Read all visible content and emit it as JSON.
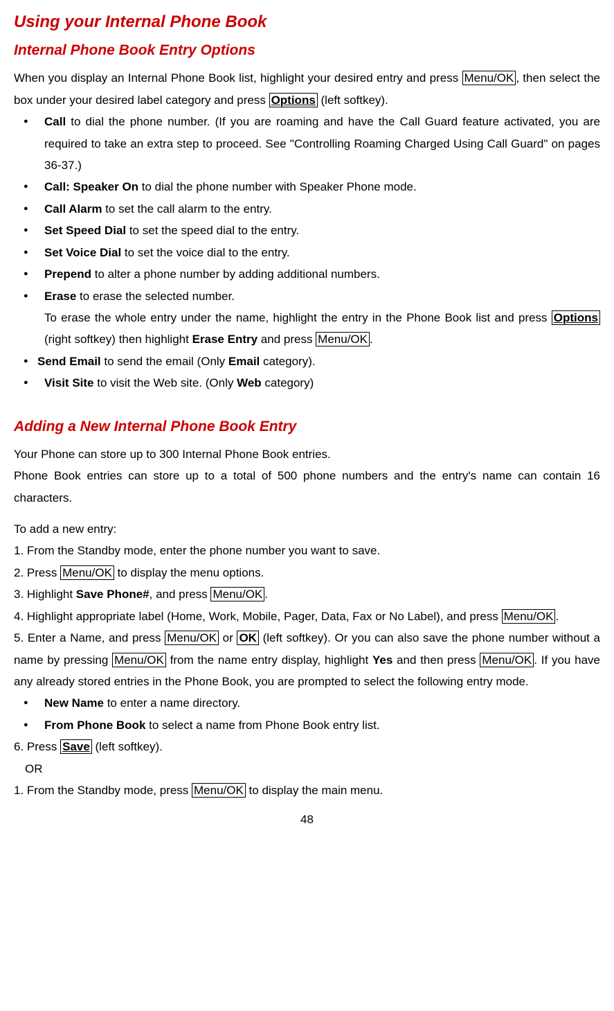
{
  "h1": "Using your Internal Phone Book",
  "h2a": "Internal Phone Book Entry Options",
  "intro": {
    "p1a": "When you display an Internal Phone Book list, highlight your desired entry and press ",
    "menuok": "Menu/OK",
    "p1b": ", then select the box under your desired label category and press ",
    "options": "Options",
    "p1c": " (left softkey)."
  },
  "b1": {
    "t1": "Call",
    "t2": " to dial the phone number. (If you are roaming and have the Call Guard feature activated, you are required to take an extra step to proceed. See \"Controlling Roaming Charged Using Call Guard\" on pages 36-37.)"
  },
  "b2": {
    "t1": "Call: Speaker On",
    "t2": " to dial the phone number with Speaker Phone mode."
  },
  "b3": {
    "t1": "Call Alarm",
    "t2": " to set the call alarm to the entry."
  },
  "b4": {
    "t1": "Set Speed Dial",
    "t2": " to set the speed dial to the entry."
  },
  "b5": {
    "t1": "Set Voice Dial",
    "t2": " to set the voice dial to the entry."
  },
  "b6": {
    "t1": "Prepend",
    "t2": " to alter a phone number by adding additional numbers."
  },
  "b7": {
    "t1": "Erase",
    "t2": " to erase the selected number."
  },
  "b7sub": {
    "a": "To erase the whole entry under the name, highlight the entry in the Phone Book list and press ",
    "options": "Options",
    "b": " (right softkey) then highlight ",
    "erase": "Erase Entry",
    "c": " and press ",
    "menuok": "Menu/OK",
    "d": "."
  },
  "b8": {
    "t1": "Send Email",
    "t2a": " to send the email (Only ",
    "t2b": "Email",
    "t2c": " category)."
  },
  "b9": {
    "t1": "Visit Site",
    "t2a": " to visit the Web site. (Only ",
    "t2b": "Web",
    "t2c": " category)"
  },
  "h2b": "Adding a New Internal Phone Book Entry",
  "add_p1": "Your Phone can store up to 300 Internal Phone Book entries.",
  "add_p2": "Phone Book entries can store up to a total of 500 phone numbers and the entry's name can contain 16 characters.",
  "add_intro": "To add a new entry:",
  "s1": "From the Standby mode, enter the phone number you want to save.",
  "s2": {
    "a": "Press ",
    "menuok": "Menu/OK",
    "b": " to display the menu options."
  },
  "s3": {
    "a": "Highlight ",
    "save": "Save Phone#",
    "b": ", and press ",
    "menuok": "Menu/OK",
    "c": "."
  },
  "s4": {
    "a": "Highlight appropriate label (Home, Work, Mobile, Pager, Data, Fax or No Label), and press ",
    "menuok": "Menu/OK",
    "b": "."
  },
  "s5": {
    "a": "Enter a Name, and press ",
    "menuok1": "Menu/OK",
    "b": " or ",
    "ok": "OK",
    "c": " (left softkey). Or you can also save the phone number without a name by pressing ",
    "menuok2": "Menu/OK",
    "d": " from the name entry display, highlight ",
    "yes": "Yes",
    "e": " and then press ",
    "menuok3": "Menu/OK",
    "f": ". If you have any already stored entries in the Phone Book, you are prompted to select the following entry mode."
  },
  "eb1": {
    "t1": "New Name",
    "t2": " to enter a name directory."
  },
  "eb2": {
    "t1": "From Phone Book",
    "t2": " to select a name from Phone Book entry list."
  },
  "s6": {
    "a": "6. Press ",
    "save": "Save",
    "b": " (left softkey)."
  },
  "or": "OR",
  "alt1": {
    "a": "1. From the Standby mode, press ",
    "menuok": "Menu/OK",
    "b": " to display the main menu."
  },
  "page": "48"
}
